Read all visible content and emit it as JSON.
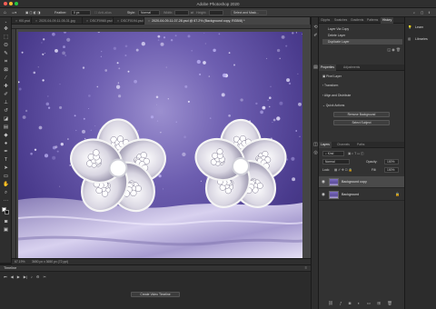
{
  "window": {
    "title": "Adobe Photoshop 2020"
  },
  "options_bar": {
    "feather_label": "Feather:",
    "feather_value": "0 px",
    "style_label": "Style:",
    "style_value": "Normal",
    "width_label": "Width:",
    "height_label": "Height:",
    "select_mask_label": "Select and Mask..."
  },
  "tabs": [
    {
      "label": "f00.psd",
      "active": false
    },
    {
      "label": "2020-04-09-11-05-31.jpg",
      "active": false
    },
    {
      "label": "DSCF0980.psd",
      "active": false
    },
    {
      "label": "DSCF0194.psd",
      "active": false
    },
    {
      "label": "2020-04-09-11-07-28.psd @ 67.2% (Background copy, RGB/8) *",
      "active": true
    }
  ],
  "status": {
    "zoom": "67.19%",
    "dimensions": "3650 px x 3650 px (72 ppi)"
  },
  "timeline": {
    "title": "Timeline",
    "create_video_label": "Create Video Timeline"
  },
  "history_panel": {
    "tabs": [
      "Glyphs",
      "Swatches",
      "Gradients",
      "Patterns",
      "History"
    ],
    "active_tab": "History",
    "items": [
      "Layer Via Copy",
      "Delete Layer",
      "Duplicate Layer"
    ],
    "selected_index": 2
  },
  "properties_panel": {
    "tabs": [
      "Properties",
      "Adjustments"
    ],
    "active_tab": "Properties",
    "kind": "Pixel Layer",
    "sections": [
      "Transform",
      "Align and Distribute",
      "Quick Actions"
    ],
    "buttons": [
      "Remove Background",
      "Select Subject"
    ]
  },
  "layers_panel": {
    "tabs": [
      "Layers",
      "Channels",
      "Paths"
    ],
    "active_tab": "Layers",
    "filter_label": "Kind",
    "blend_mode": "Normal",
    "opacity_label": "Opacity:",
    "opacity_value": "100%",
    "lock_label": "Lock:",
    "fill_label": "Fill:",
    "fill_value": "100%",
    "layers": [
      {
        "name": "Background copy",
        "selected": true
      },
      {
        "name": "Background",
        "selected": false
      }
    ]
  },
  "side_panels": [
    {
      "label": "Learn",
      "icon": "learn-icon"
    },
    {
      "label": "Libraries",
      "icon": "libraries-icon"
    }
  ],
  "colors": {
    "accent_selected": "#4b4b4b",
    "photo_purple": "#6d5eb0",
    "close_red": "#ff5f57",
    "min_yellow": "#febc2e",
    "max_green": "#28c840"
  }
}
